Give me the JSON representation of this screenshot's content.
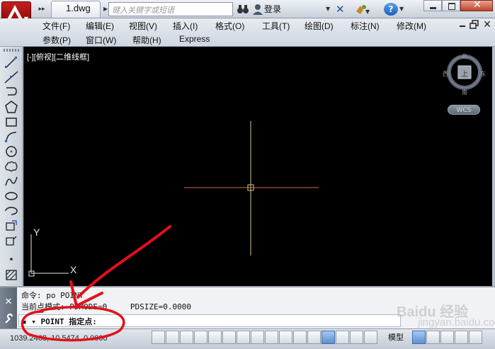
{
  "titlebar": {
    "doc_tab": "1.dwg",
    "search_placeholder": "键入关键字或短语",
    "login": "登录"
  },
  "menu": {
    "row1": [
      "文件(F)",
      "编辑(E)",
      "视图(V)",
      "插入(I)",
      "格式(O)",
      "工具(T)",
      "绘图(D)",
      "标注(N)",
      "修改(M)"
    ],
    "row2": [
      "参数(P)",
      "窗口(W)",
      "帮助(H)",
      "Express"
    ]
  },
  "viewport": {
    "label": "[-][俯视][二维线框]",
    "compass": {
      "north": "北",
      "south": "南",
      "east": "东",
      "west": "西",
      "top": "上"
    },
    "wcs": "WCS",
    "ucs_x": "X",
    "ucs_y": "Y"
  },
  "command": {
    "line1": "命令: po POINT",
    "line2_prefix": "当前点模式:  PDMODE=0",
    "line2_suffix": "PDSIZE=0.0000",
    "input": "▪ ▾ POINT 指定点:"
  },
  "status": {
    "coords": "1039.2468, 10.5474, 0.0000",
    "model": "模型"
  },
  "watermark": {
    "text": "Baidu 经验",
    "site": "jingyan.baidu.com"
  },
  "colors": {
    "canvas": "#000000",
    "crosshair_h": "#c8744a",
    "crosshair_v": "#d8c49a",
    "annotation": "#e3101a",
    "app_red": "#b11616"
  }
}
